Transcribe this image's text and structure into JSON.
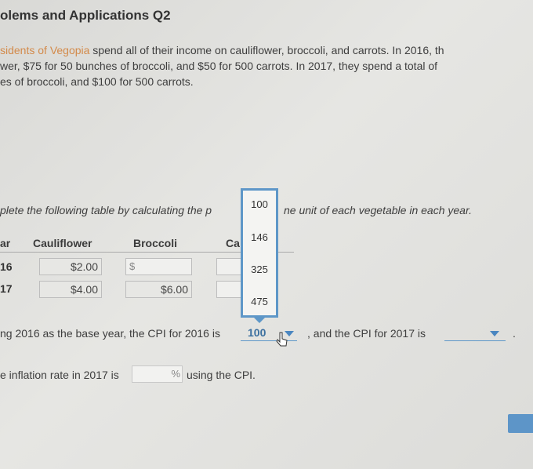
{
  "title": "olems and Applications Q2",
  "intro": {
    "line1_a": "sidents of Vegopia",
    "line1_b": " spend all of their income on cauliflower, broccoli, and carrots. In 2016, th",
    "line2": "wer, $75 for 50 bunches of broccoli, and $50 for 500 carrots. In 2017, they spend a total of",
    "line3": "es of broccoli, and $100 for 500 carrots."
  },
  "instruction": {
    "left": "plete the following table by calculating the p",
    "right": "ne unit of each vegetable in each year."
  },
  "table": {
    "headers": {
      "year": "ar",
      "cauliflower": "Cauliflower",
      "broccoli": "Broccoli",
      "carrots": "Ca"
    },
    "rows": [
      {
        "year": "16",
        "cauliflower": "$2.00",
        "broccoli_prefix": "$",
        "broccoli": "",
        "carrots": ""
      },
      {
        "year": "17",
        "cauliflower": "$4.00",
        "broccoli": "$6.00",
        "carrots": ""
      }
    ]
  },
  "dropdown_options": [
    "100",
    "146",
    "325",
    "475"
  ],
  "cpi": {
    "text_before": "ng 2016 as the base year, the CPI for 2016 is",
    "selected_2016": "100",
    "text_middle": ", and the CPI for 2017 is",
    "selected_2017": "",
    "text_end": "."
  },
  "inflation": {
    "text_before": "e inflation rate in 2017 is",
    "pct_sign": "%",
    "text_after": "using the CPI."
  },
  "colors": {
    "accent": "#5e97c8",
    "orange_text": "#d38a4a"
  }
}
